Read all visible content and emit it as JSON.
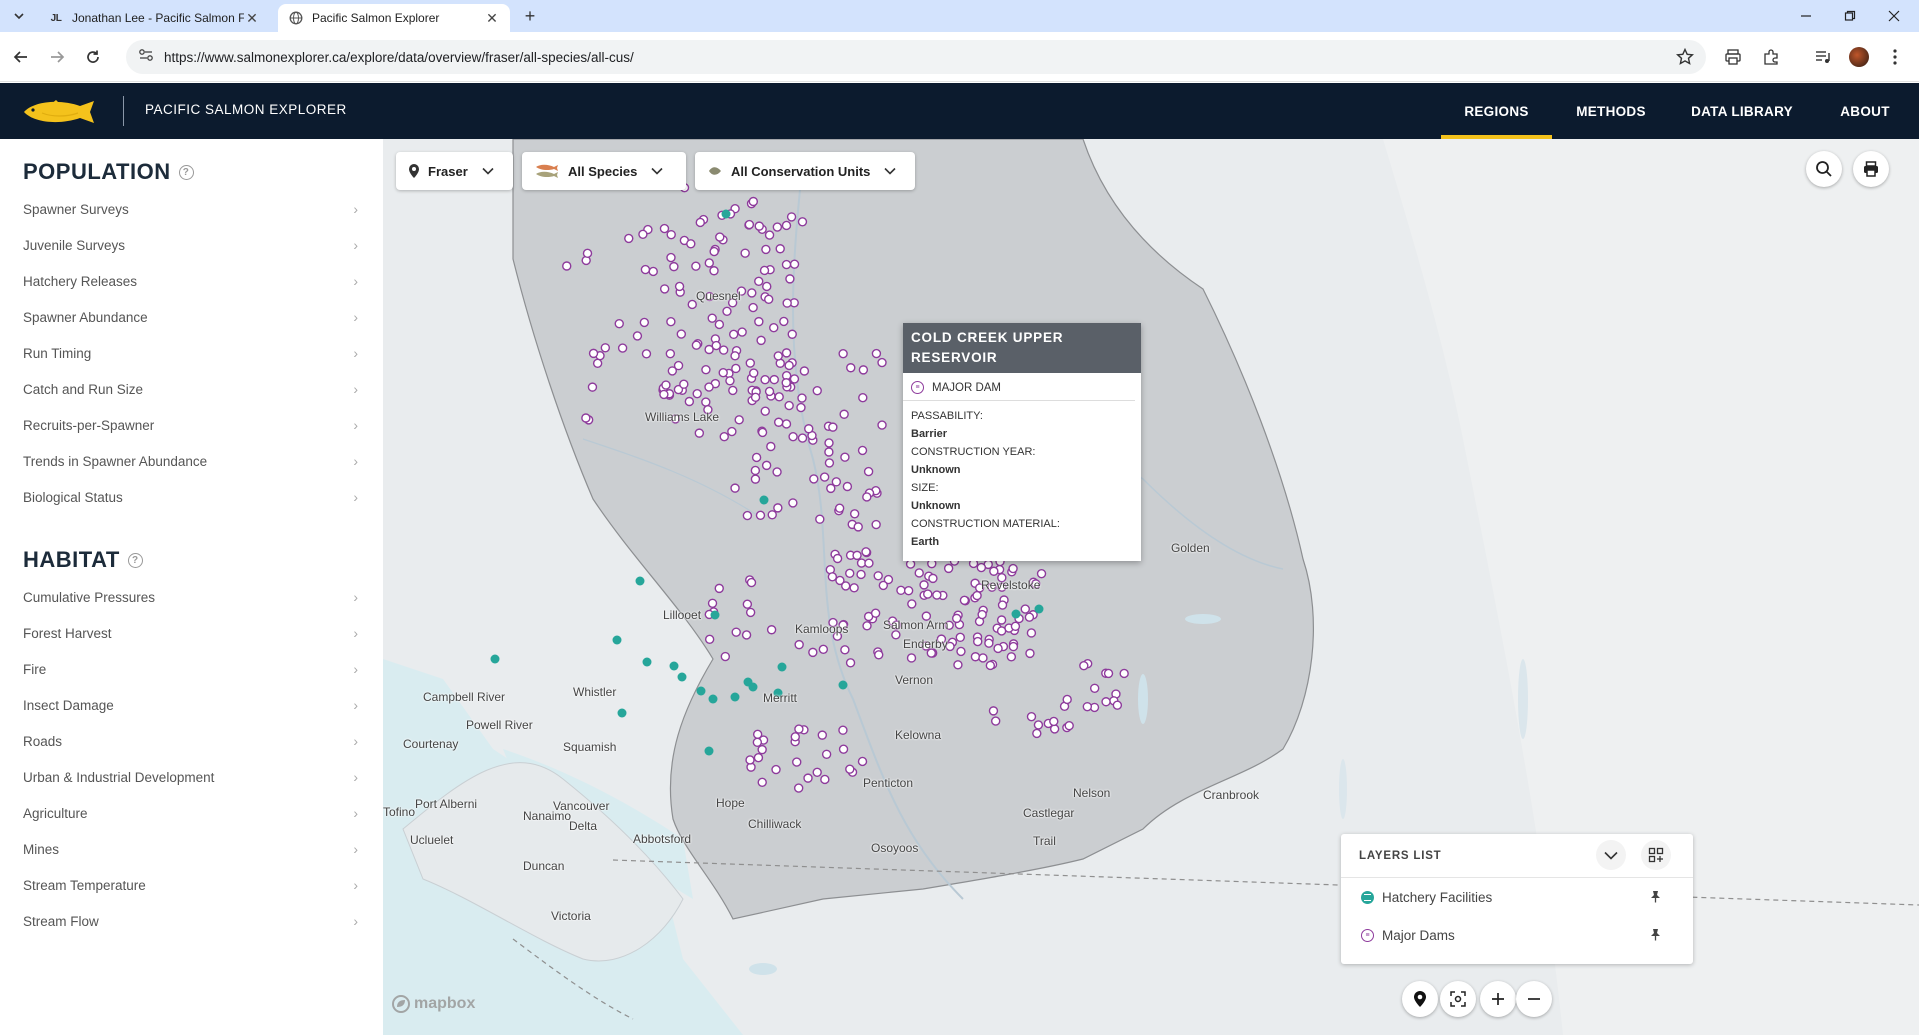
{
  "browser": {
    "tabs": [
      {
        "title": "Jonathan Lee - Pacific Salmon F",
        "favicon": "JL",
        "active": false
      },
      {
        "title": "Pacific Salmon Explorer",
        "active": true
      }
    ],
    "url": "https://www.salmonexplorer.ca/explore/data/overview/fraser/all-species/all-cus/"
  },
  "site": {
    "title": "PACIFIC SALMON EXPLORER",
    "nav": [
      {
        "label": "REGIONS",
        "active": true
      },
      {
        "label": "METHODS",
        "active": false
      },
      {
        "label": "DATA LIBRARY",
        "active": false
      },
      {
        "label": "ABOUT",
        "active": false
      }
    ],
    "accent_color": "#f4c21c",
    "header_color": "#0c1b2e"
  },
  "sidebar": {
    "population": {
      "heading": "POPULATION",
      "items": [
        "Spawner Surveys",
        "Juvenile Surveys",
        "Hatchery Releases",
        "Spawner Abundance",
        "Run Timing",
        "Catch and Run Size",
        "Recruits-per-Spawner",
        "Trends in Spawner Abundance",
        "Biological Status"
      ]
    },
    "habitat": {
      "heading": "HABITAT",
      "items": [
        "Cumulative Pressures",
        "Forest Harvest",
        "Fire",
        "Insect Damage",
        "Roads",
        "Urban & Industrial Development",
        "Agriculture",
        "Mines",
        "Stream Temperature",
        "Stream Flow"
      ]
    }
  },
  "filters": {
    "region": "Fraser",
    "species": "All Species",
    "cu": "All Conservation Units"
  },
  "popup": {
    "title": "COLD CREEK UPPER RESERVOIR",
    "type": "MAJOR DAM",
    "fields": [
      {
        "label": "PASSABILITY:",
        "value": "Barrier"
      },
      {
        "label": "CONSTRUCTION YEAR:",
        "value": "Unknown"
      },
      {
        "label": "SIZE:",
        "value": "Unknown"
      },
      {
        "label": "CONSTRUCTION MATERIAL:",
        "value": "Earth"
      }
    ]
  },
  "layers": {
    "heading": "LAYERS LIST",
    "items": [
      {
        "label": "Hatchery Facilities",
        "color": "#26a69a"
      },
      {
        "label": "Major Dams",
        "color": "#8e3b9c"
      }
    ]
  },
  "map_labels": [
    "Quesnel",
    "Williams Lake",
    "Golden",
    "Revelstoke",
    "Lillooet",
    "Kamloops",
    "Salmon Arm",
    "Enderby",
    "Campbell River",
    "Powell River",
    "Whistler",
    "Vernon",
    "Merritt",
    "Courtenay",
    "Squamish",
    "Kelowna",
    "Port Alberni",
    "Nanaimo",
    "Vancouver",
    "Hope",
    "Chilliwack",
    "Delta",
    "Abbotsford",
    "Tofino",
    "Ucluelet",
    "Duncan",
    "Victoria",
    "Penticton",
    "Nelson",
    "Castlegar",
    "Cranbrook",
    "Osoyoos",
    "Trail"
  ],
  "attribution": "mapbox"
}
